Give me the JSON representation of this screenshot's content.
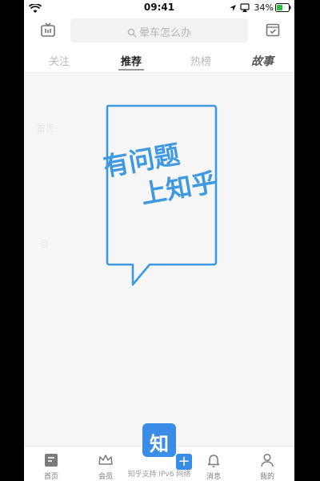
{
  "status": {
    "time": "09:41",
    "battery": "34%"
  },
  "search": {
    "placeholder": "晕车怎么办"
  },
  "tabs": [
    {
      "label": "关注",
      "active": false
    },
    {
      "label": "推荐",
      "active": true
    },
    {
      "label": "热榜",
      "active": false
    },
    {
      "label": "故事",
      "active": false
    }
  ],
  "slogan": {
    "line1": "有问题",
    "line2": "上知乎"
  },
  "ghost_labels": [
    "首页",
    "目"
  ],
  "logo": {
    "char": "知"
  },
  "footer_note": "知乎支持 IPv6 网络",
  "bottom_nav": [
    {
      "label": "首页",
      "icon": "home-icon"
    },
    {
      "label": "会员",
      "icon": "crown-icon"
    },
    {
      "label": "消息",
      "icon": "bell-icon"
    },
    {
      "label": "我的",
      "icon": "profile-icon"
    }
  ],
  "colors": {
    "brand": "#3a8de6",
    "slogan": "#3d99e2"
  }
}
